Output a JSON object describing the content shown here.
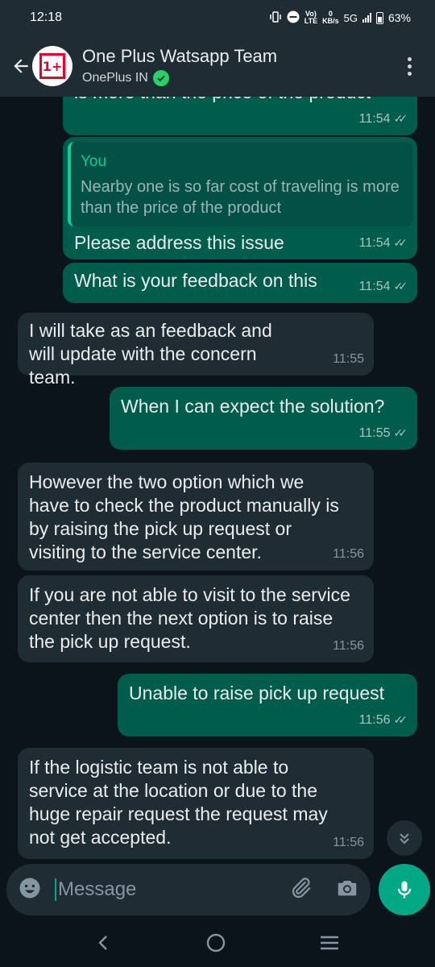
{
  "status_bar": {
    "time": "12:18",
    "net_top": "Vo)",
    "net_bottom": "LTE",
    "speed_top": "0",
    "speed_bottom": "KB/s",
    "network": "5G",
    "battery": "63%"
  },
  "header": {
    "title": "One Plus Watsapp Team",
    "subtitle": "OnePlus IN",
    "avatar_text": "1+"
  },
  "messages": [
    {
      "dir": "out",
      "text": "is more than the price of the product",
      "time": "11:54"
    },
    {
      "dir": "out",
      "quote_name": "You",
      "quote_text": "Nearby one is so far cost of traveling is more than the price of the product",
      "text": "Please address this issue",
      "time": "11:54"
    },
    {
      "dir": "out",
      "text": "What is your feedback on this",
      "time": "11:54"
    },
    {
      "dir": "in",
      "text": "I will take as an feedback and will update with the concern team.",
      "time": "11:55"
    },
    {
      "dir": "out",
      "text": "When I can expect the solution?",
      "time": "11:55"
    },
    {
      "dir": "in",
      "text": "However the two option which we have to check the product manually is by raising the pick up request or visiting to the service center.",
      "time": "11:56"
    },
    {
      "dir": "in",
      "text": "If you are not able to visit to the service center then the next option is to raise the pick up request.",
      "time": "11:56"
    },
    {
      "dir": "out",
      "text": "Unable to raise pick up request",
      "time": "11:56"
    },
    {
      "dir": "in",
      "text": "If the logistic team is not able to service at the location or due to the huge repair request the request may not get accepted.",
      "time": "11:56"
    }
  ],
  "input": {
    "placeholder": "Message"
  },
  "colors": {
    "outgoing_bubble": "#005c4b",
    "incoming_bubble": "#202c33",
    "accent": "#00a884",
    "background": "#0b141a"
  },
  "icons": [
    "back-arrow-icon",
    "verified-icon",
    "more-options-icon",
    "emoji-icon",
    "attach-icon",
    "camera-icon",
    "mic-icon",
    "scroll-down-icon",
    "nav-back-icon",
    "nav-home-icon",
    "nav-recents-icon"
  ]
}
